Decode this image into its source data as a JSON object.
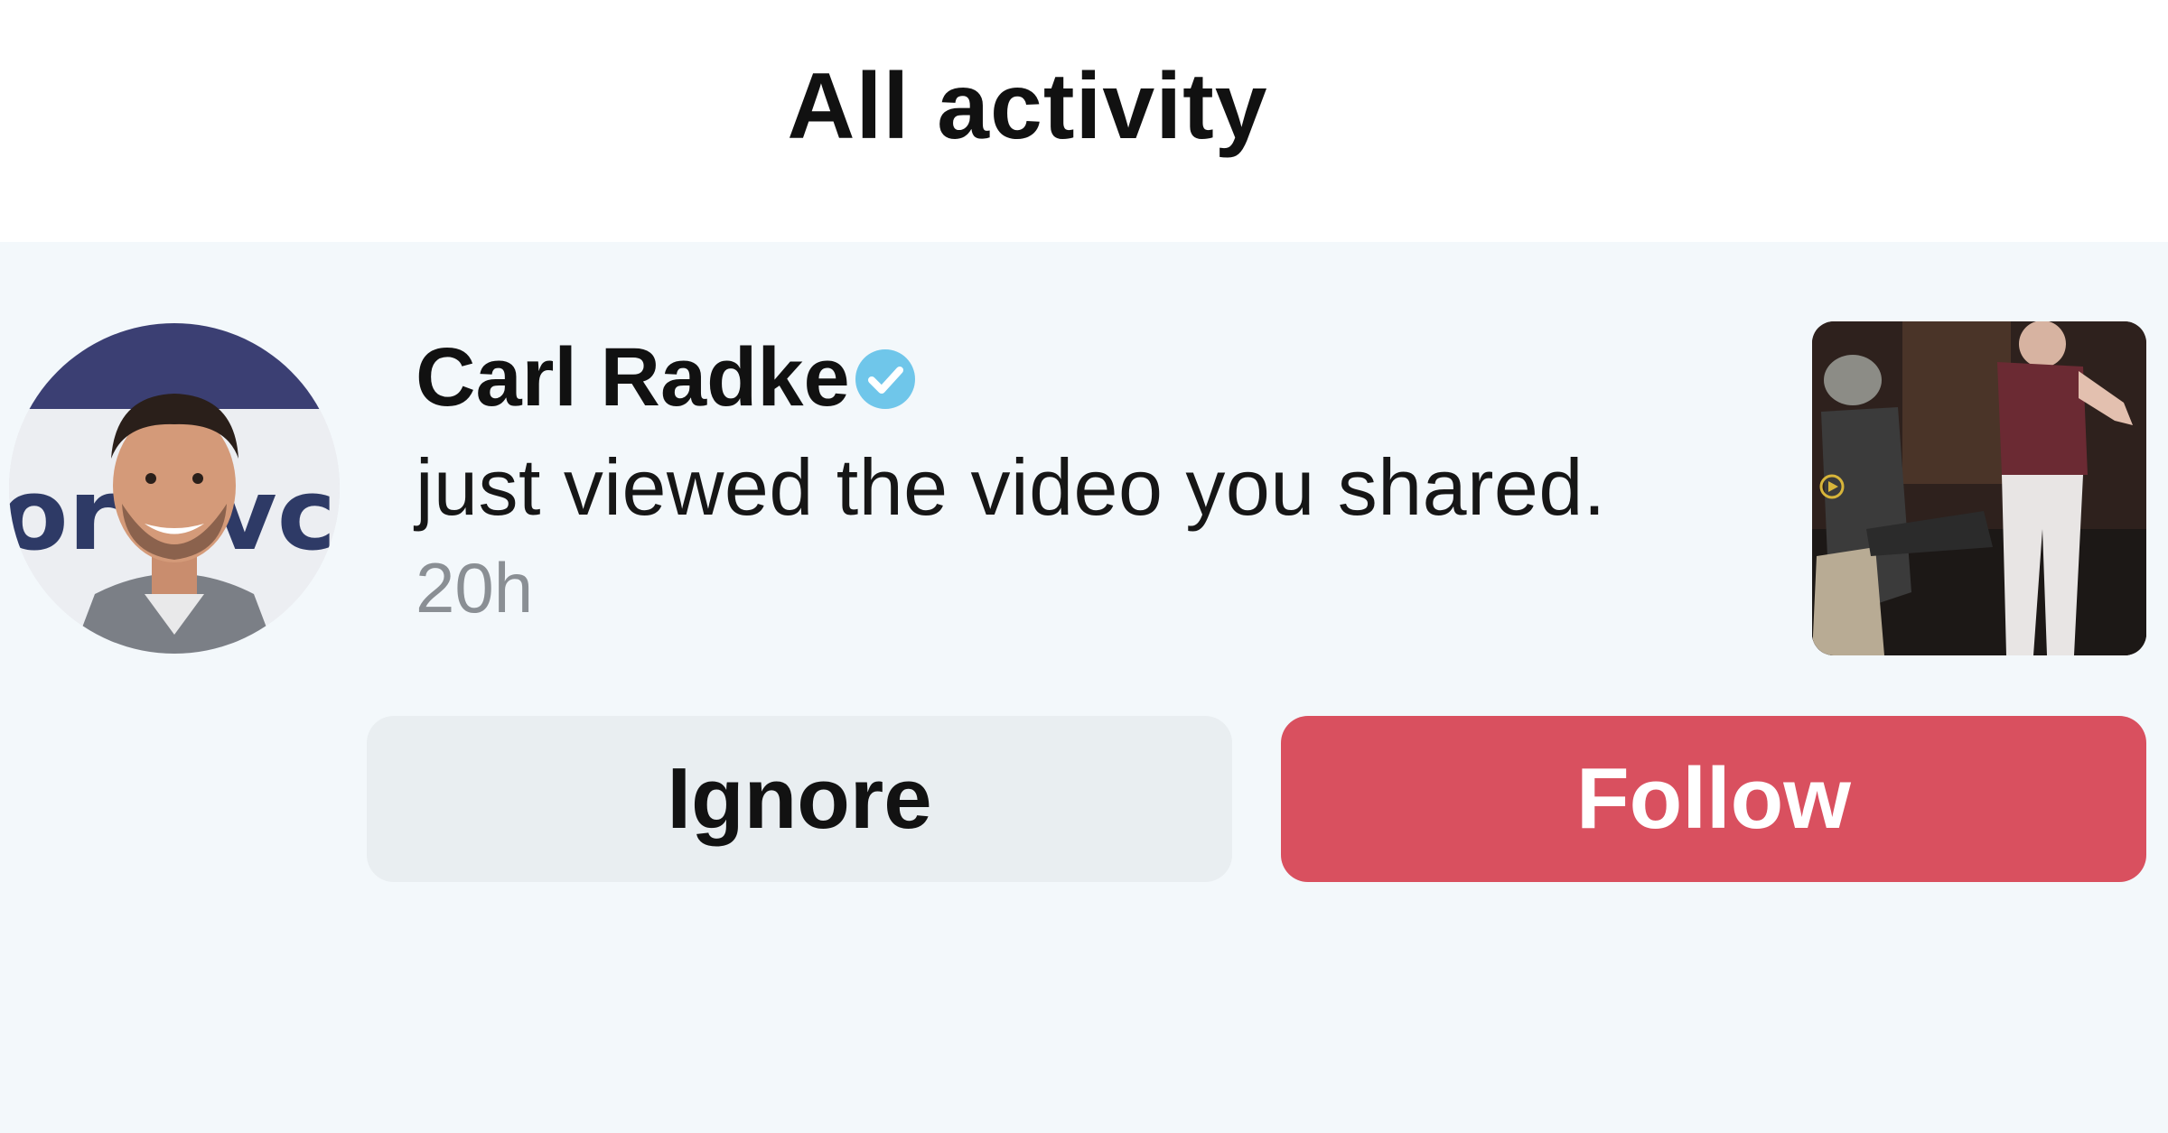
{
  "header": {
    "title": "All activity"
  },
  "notification": {
    "user_name": "Carl Radke",
    "verified": true,
    "message": "just viewed the video you shared.",
    "time": "20h",
    "avatar_icon": "profile-photo",
    "thumbnail_icon": "video-thumbnail"
  },
  "actions": {
    "ignore_label": "Ignore",
    "follow_label": "Follow"
  },
  "colors": {
    "follow_button": "#d9505f",
    "ignore_button": "#e9eef1",
    "verified_badge": "#6fc6ea",
    "background": "#f3f8fb"
  }
}
